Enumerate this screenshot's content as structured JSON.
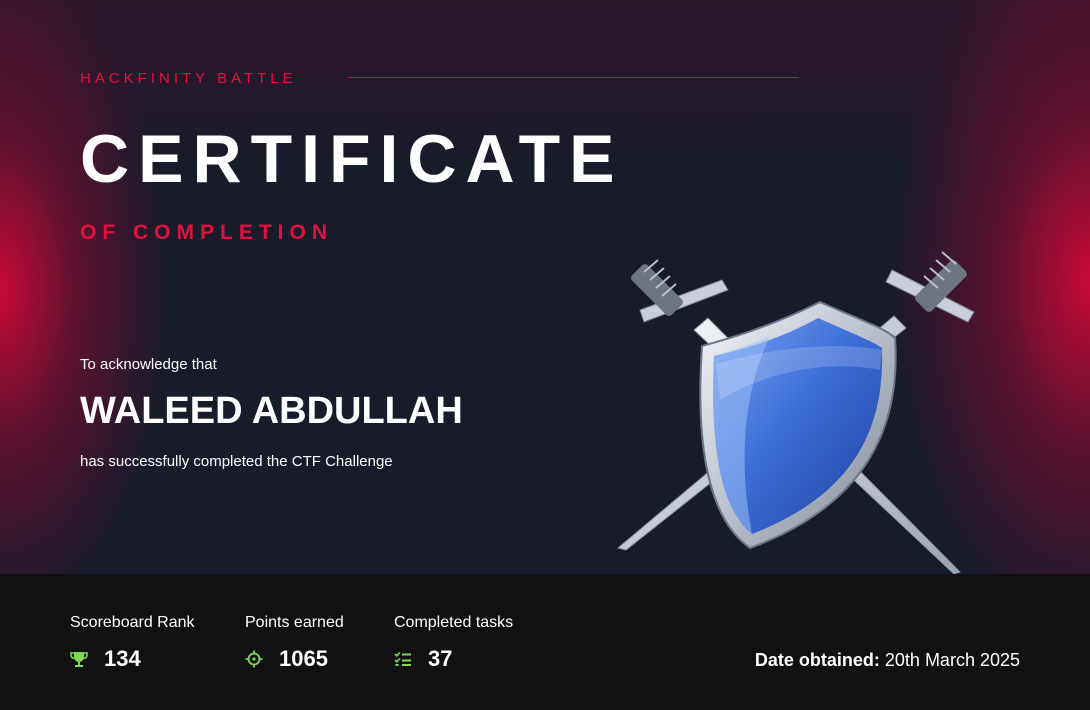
{
  "certificate": {
    "eyebrow": "HACKFINITY BATTLE",
    "title": "CERTIFICATE",
    "subtitle": "OF COMPLETION",
    "acknowledge": "To acknowledge that",
    "recipient": "WALEED ABDULLAH",
    "completed_text": "has successfully completed the CTF Challenge",
    "emblem": "shield-with-crossed-swords"
  },
  "stats": [
    {
      "label": "Scoreboard Rank",
      "value": "134",
      "icon": "trophy-icon"
    },
    {
      "label": "Points earned",
      "value": "1065",
      "icon": "crosshair-icon"
    },
    {
      "label": "Completed tasks",
      "value": "37",
      "icon": "checklist-icon"
    }
  ],
  "date": {
    "label": "Date obtained:",
    "value": "20th March 2025"
  },
  "colors": {
    "accent": "#e0103f",
    "icon_green": "#7ed957",
    "background": "#171b2a",
    "footer": "#111111"
  }
}
